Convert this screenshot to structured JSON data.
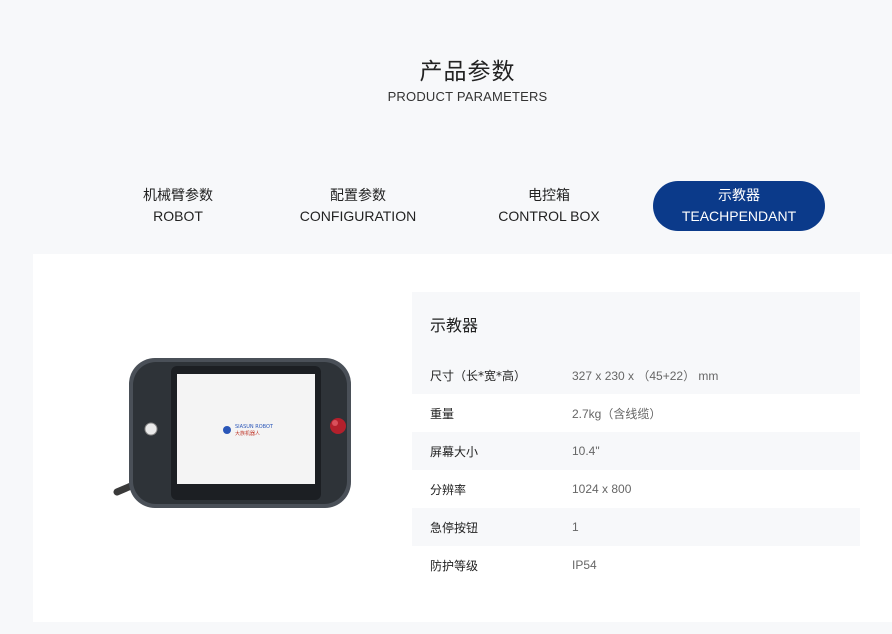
{
  "header": {
    "title_cn": "产品参数",
    "title_en": "PRODUCT PARAMETERS"
  },
  "tabs": [
    {
      "cn": "机械臂参数",
      "en": "ROBOT",
      "active": false
    },
    {
      "cn": "配置参数",
      "en": "CONFIGURATION",
      "active": false
    },
    {
      "cn": "电控箱",
      "en": "CONTROL BOX",
      "active": false
    },
    {
      "cn": "示教器",
      "en": "TEACHPENDANT",
      "active": true
    }
  ],
  "colors": {
    "accent": "#0b3a8a",
    "page_bg": "#f7f8fa",
    "device_button": "#b3202c"
  },
  "device": {
    "screen_logo_line1": "SIASUN ROBOT",
    "screen_logo_line2": "大族机器人"
  },
  "spec": {
    "heading": "示教器",
    "rows": [
      {
        "key": "尺寸（长*宽*高）",
        "value": "327 x 230 x （45+22） mm"
      },
      {
        "key": "重量",
        "value": "2.7kg（含线缆）"
      },
      {
        "key": "屏幕大小",
        "value": "10.4\""
      },
      {
        "key": "分辨率",
        "value": "1024 x 800"
      },
      {
        "key": "急停按钮",
        "value": "1"
      },
      {
        "key": "防护等级",
        "value": "IP54"
      }
    ]
  }
}
